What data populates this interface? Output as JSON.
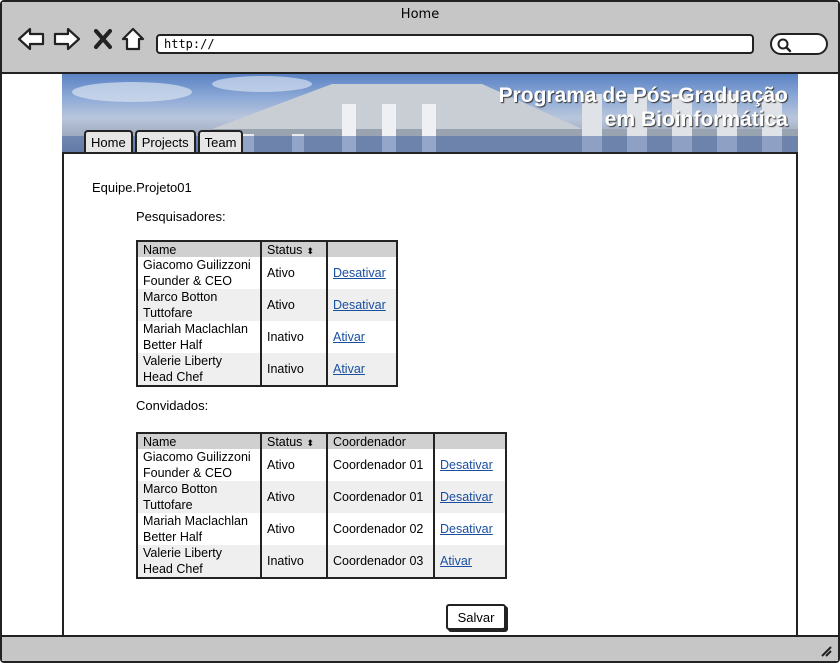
{
  "window": {
    "title": "Home"
  },
  "browser": {
    "url": "http://",
    "icons": [
      "back-arrow-icon",
      "forward-arrow-icon",
      "close-x-icon",
      "home-icon",
      "search-icon"
    ]
  },
  "header": {
    "title_line1": "Programa de Pós-Graduação",
    "title_line2": "em Bioinformática"
  },
  "tabs": [
    {
      "label": "Home"
    },
    {
      "label": "Projects"
    },
    {
      "label": "Team"
    }
  ],
  "page": {
    "breadcrumb": "Equipe.Projeto01",
    "researchers_label": "Pesquisadores:",
    "guests_label": "Convidados:"
  },
  "researchers": {
    "columns": [
      "Name",
      "Status",
      ""
    ],
    "rows": [
      {
        "name1": "Giacomo Guilizzoni",
        "name2": "Founder & CEO",
        "status": "Ativo",
        "action": "Desativar"
      },
      {
        "name1": "Marco Botton",
        "name2": "Tuttofare",
        "status": "Ativo",
        "action": "Desativar"
      },
      {
        "name1": "Mariah Maclachlan",
        "name2": "Better Half",
        "status": "Inativo",
        "action": "Ativar"
      },
      {
        "name1": "Valerie Liberty",
        "name2": "Head Chef",
        "status": "Inativo",
        "action": "Ativar"
      }
    ]
  },
  "guests": {
    "columns": [
      "Name",
      "Status",
      "Coordenador",
      ""
    ],
    "rows": [
      {
        "name1": "Giacomo Guilizzoni",
        "name2": "Founder & CEO",
        "status": "Ativo",
        "coord": "Coordenador 01",
        "action": "Desativar"
      },
      {
        "name1": "Marco Botton",
        "name2": "Tuttofare",
        "status": "Ativo",
        "coord": "Coordenador 01",
        "action": "Desativar"
      },
      {
        "name1": "Mariah Maclachlan",
        "name2": "Better Half",
        "status": "Ativo",
        "coord": "Coordenador 02",
        "action": "Desativar"
      },
      {
        "name1": "Valerie Liberty",
        "name2": "Head Chef",
        "status": "Inativo",
        "coord": "Coordenador 03",
        "action": "Ativar"
      }
    ]
  },
  "actions": {
    "save_label": "Salvar"
  },
  "colors": {
    "link": "#1a4fa0",
    "chrome": "#c6c6c6",
    "header_header": "#c6c6c6"
  }
}
